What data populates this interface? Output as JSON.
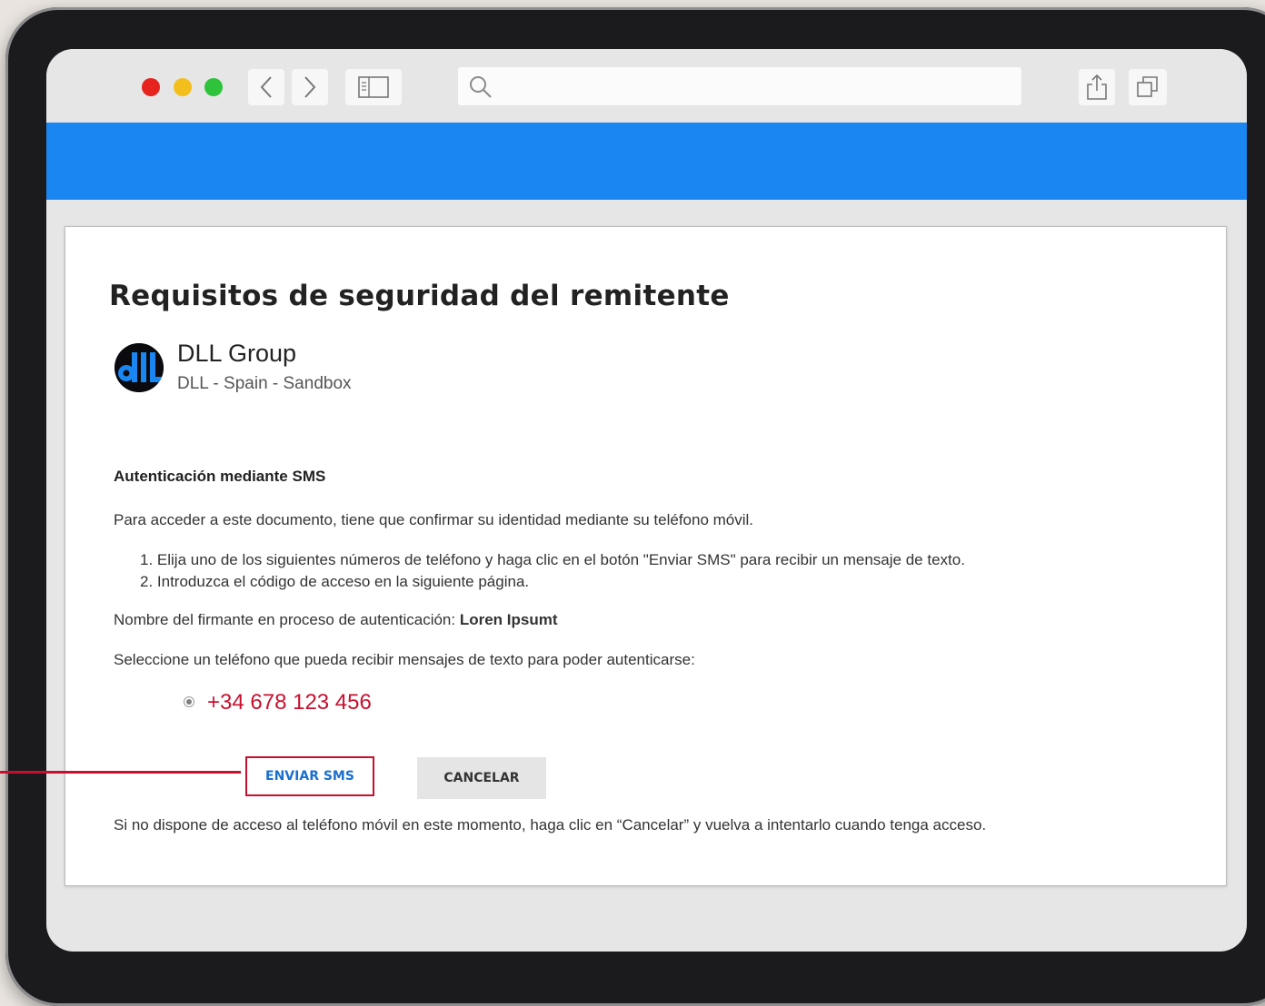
{
  "browser": {
    "window_controls": [
      "close",
      "minimize",
      "zoom"
    ],
    "icons": [
      "back-icon",
      "forward-icon",
      "sidebar-icon",
      "search-icon",
      "share-icon",
      "tabs-icon"
    ],
    "url_value": ""
  },
  "colors": {
    "brand_bar": "#1a86f2",
    "highlight": "#c8102e",
    "link_blue": "#1a6fd0"
  },
  "page": {
    "title": "Requisitos de seguridad del remitente",
    "org": {
      "name": "DLL Group",
      "subtitle": "DLL - Spain - Sandbox",
      "logo_text": "dlL"
    },
    "sms": {
      "heading": "Autenticación mediante SMS",
      "intro": "Para acceder a este documento, tiene que confirmar su identidad mediante su teléfono móvil.",
      "steps": [
        "1. Elija uno de los siguientes números de teléfono y haga clic en el botón \"Enviar SMS\" para recibir un mensaje de texto.",
        "2. Introduzca el código de acceso en la siguiente página."
      ],
      "signer_label": "Nombre del firmante en proceso de autenticación:",
      "signer_name": "Loren Ipsumt",
      "select_prompt": "Seleccione un teléfono que pueda recibir mensajes de texto para poder autenticarse:",
      "phone": "+34 678 123 456",
      "send_button": "ENVIAR SMS",
      "cancel_button": "CANCELAR",
      "footer_note": "Si no dispone de acceso al teléfono móvil en este momento, haga clic en “Cancelar” y vuelva a intentarlo cuando tenga acceso."
    }
  }
}
